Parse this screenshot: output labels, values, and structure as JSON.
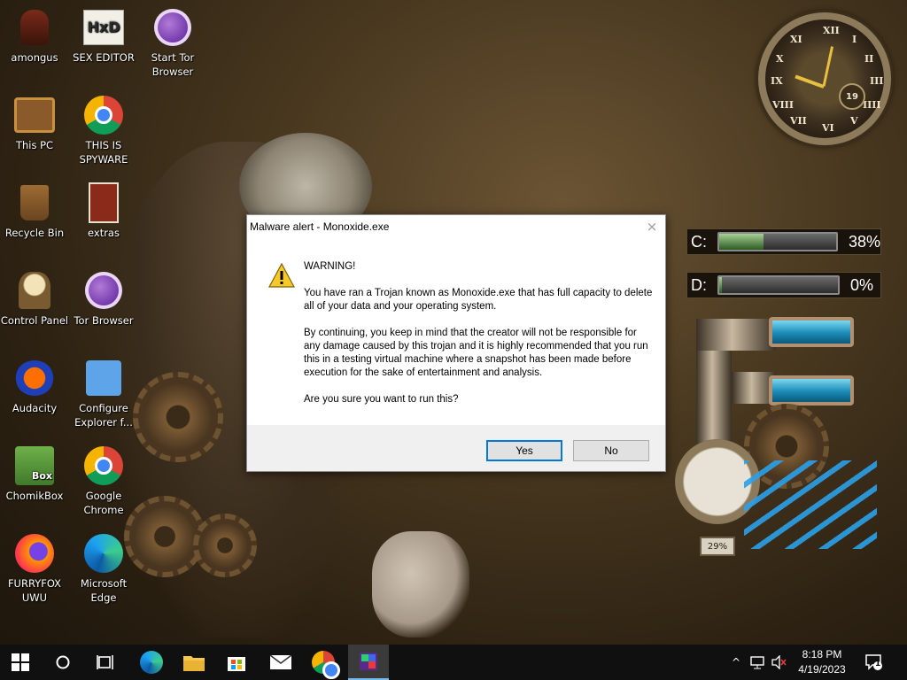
{
  "desktop_icons": [
    {
      "label": "amongus"
    },
    {
      "label": "SEX EDITOR"
    },
    {
      "label": "Start Tor Browser"
    },
    {
      "label": "This PC"
    },
    {
      "label": "THIS IS SPYWARE"
    },
    {
      "label": "Recycle Bin"
    },
    {
      "label": "extras"
    },
    {
      "label": "Control Panel"
    },
    {
      "label": "Tor Browser"
    },
    {
      "label": "Audacity"
    },
    {
      "label": "Configure Explorer f..."
    },
    {
      "label": "ChomikBox"
    },
    {
      "label": "Google Chrome"
    },
    {
      "label": "FURRYFOX UWU"
    },
    {
      "label": "Microsoft Edge"
    }
  ],
  "hxd_glyph": "HxD",
  "chomik_glyph": "Box",
  "widgets": {
    "clock": {
      "numerals": [
        "XII",
        "I",
        "II",
        "III",
        "IIII",
        "V",
        "VI",
        "VII",
        "VIII",
        "IX",
        "X",
        "XI"
      ],
      "date": "19"
    },
    "drives": [
      {
        "letter": "C:",
        "percent": "38%",
        "fill": 0.38
      },
      {
        "letter": "D:",
        "percent": "0%",
        "fill": 0.0
      }
    ],
    "pressure_readout": "29%"
  },
  "dialog": {
    "title": "Malware alert - Monoxide.exe",
    "close_glyph": "×",
    "paragraphs": [
      "WARNING!",
      "You have ran a Trojan known as Monoxide.exe that has full capacity to delete all of your data and your operating system.",
      "By continuing, you keep in mind that the creator will not be responsible for any damage caused by this trojan and it is highly recommended that you run this in a testing virtual machine where a snapshot has been made before execution for the sake of entertainment and analysis.",
      "Are you sure you want to run this?"
    ],
    "yes_label": "Yes",
    "no_label": "No"
  },
  "taskbar": {
    "time": "8:18 PM",
    "date": "4/19/2023",
    "notification_count": "1",
    "chevron": "^"
  },
  "colors": {
    "accent": "#0078d7",
    "taskbar": "#101010"
  }
}
